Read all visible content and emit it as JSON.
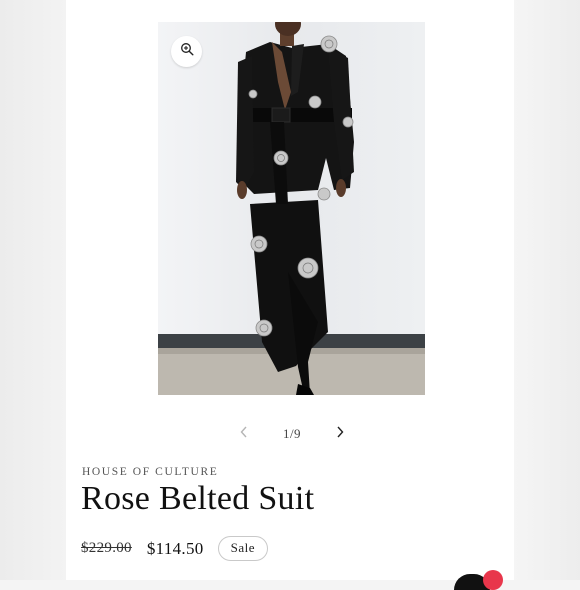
{
  "product": {
    "image_alt": "Model wearing black belted suit with rose appliqués",
    "brand": "HOUSE OF CULTURE",
    "title": "Rose Belted Suit",
    "original_price": "$229.00",
    "sale_price": "$114.50",
    "badge": "Sale"
  },
  "gallery": {
    "counter": "1/9",
    "prev_icon": "chevron-left-icon",
    "next_icon": "chevron-right-icon",
    "zoom_icon": "zoom-in-icon"
  },
  "colors": {
    "badge_border": "#c9c9c9",
    "notification": "#e8364b",
    "suit": "#111111"
  }
}
